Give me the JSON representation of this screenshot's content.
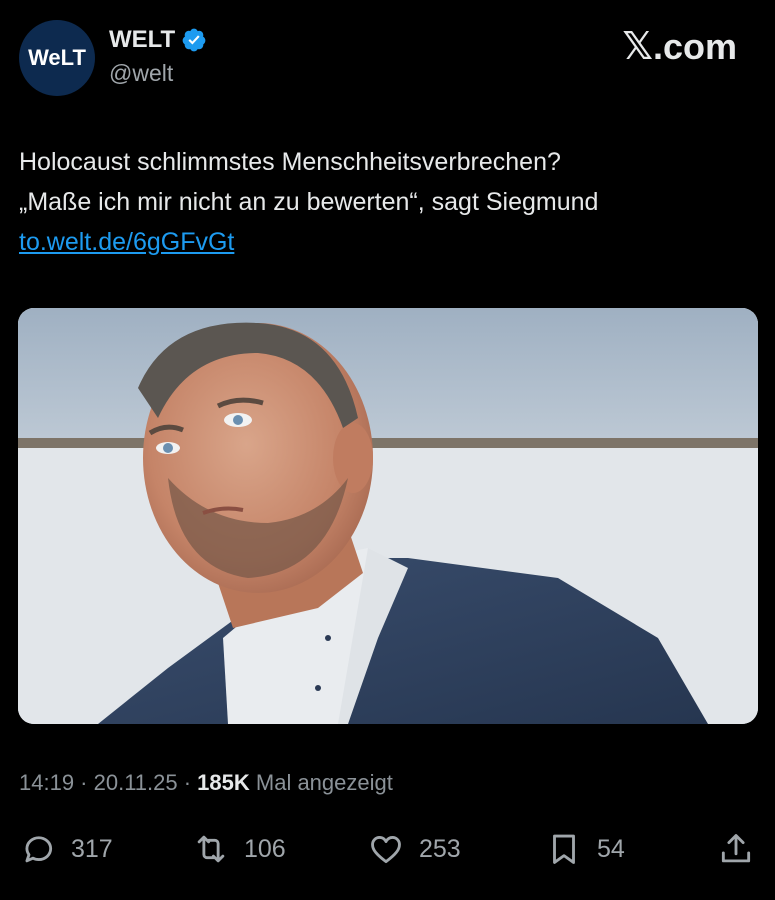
{
  "account": {
    "avatar_text": "WeLT",
    "name": "WELT",
    "handle": "@welt",
    "verified": true
  },
  "brand": {
    "logo_x": "𝕏",
    "logo_text": ".com"
  },
  "tweet": {
    "line1": "Holocaust schlimmstes Menschheitsverbrechen?",
    "line2": "„Maße ich mir nicht an zu bewerten“, sagt Siegmund",
    "link": "to.welt.de/6gGFvGt"
  },
  "meta": {
    "time_date": "14:19 · 20.11.25 · ",
    "views": "185K",
    "views_label": " Mal angezeigt"
  },
  "actions": {
    "replies": "317",
    "reposts": "106",
    "likes": "253",
    "bookmarks": "54"
  },
  "colors": {
    "background": "#000000",
    "link": "#1d9bf0",
    "verified": "#1d9bf0"
  }
}
